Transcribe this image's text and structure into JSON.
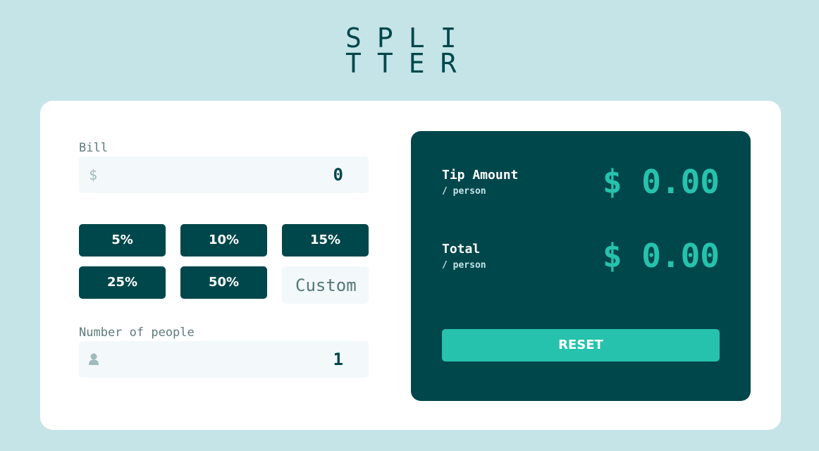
{
  "logo": {
    "line1": "SPLI",
    "line2": "TTER"
  },
  "bill": {
    "label": "Bill",
    "currency_symbol": "$",
    "value": "0"
  },
  "tips": {
    "options": [
      "5%",
      "10%",
      "15%",
      "25%",
      "50%"
    ],
    "custom_placeholder": "Custom"
  },
  "people": {
    "label": "Number of people",
    "value": "1",
    "icon": "person-icon"
  },
  "results": {
    "tip": {
      "title": "Tip Amount",
      "sub": "/ person",
      "amount": "$ 0.00"
    },
    "total": {
      "title": "Total",
      "sub": "/ person",
      "amount": "$ 0.00"
    },
    "reset_label": "RESET"
  },
  "colors": {
    "background": "#c5e4e7",
    "dark_cyan": "#00474b",
    "accent": "#26c2ad",
    "input_bg": "#f3f8fb"
  }
}
